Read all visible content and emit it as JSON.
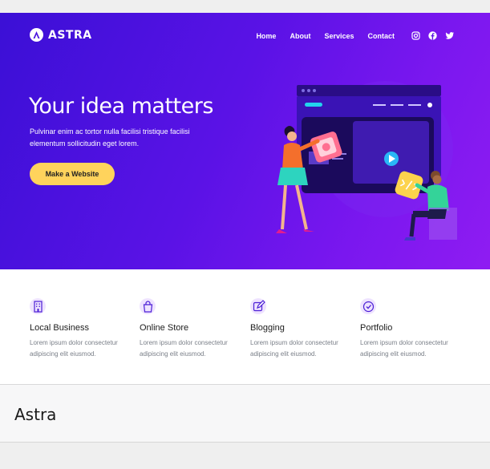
{
  "header": {
    "logo_text": "ASTRA",
    "nav": [
      {
        "label": "Home"
      },
      {
        "label": "About"
      },
      {
        "label": "Services"
      },
      {
        "label": "Contact"
      }
    ],
    "social_icons": [
      "instagram-icon",
      "facebook-icon",
      "twitter-icon"
    ]
  },
  "hero": {
    "headline": "Your idea matters",
    "subtext": "Pulvinar enim ac tortor nulla facilisi tristique facilisi elementum sollicitudin eget lorem.",
    "cta_label": "Make a Website",
    "colors": {
      "gradient_start": "#3b10d6",
      "gradient_end": "#8f1cf2",
      "cta": "#ffd35c"
    }
  },
  "features": [
    {
      "icon": "building-icon",
      "title": "Local Business",
      "desc": "Lorem ipsum dolor consectetur adipiscing elit eiusmod."
    },
    {
      "icon": "shopping-bag-icon",
      "title": "Online Store",
      "desc": "Lorem ipsum dolor consectetur adipiscing elit eiusmod."
    },
    {
      "icon": "edit-icon",
      "title": "Blogging",
      "desc": "Lorem ipsum dolor consectetur adipiscing elit eiusmod."
    },
    {
      "icon": "badge-check-icon",
      "title": "Portfolio",
      "desc": "Lorem ipsum dolor consectetur adipiscing elit eiusmod."
    }
  ],
  "site": {
    "title": "Astra"
  }
}
